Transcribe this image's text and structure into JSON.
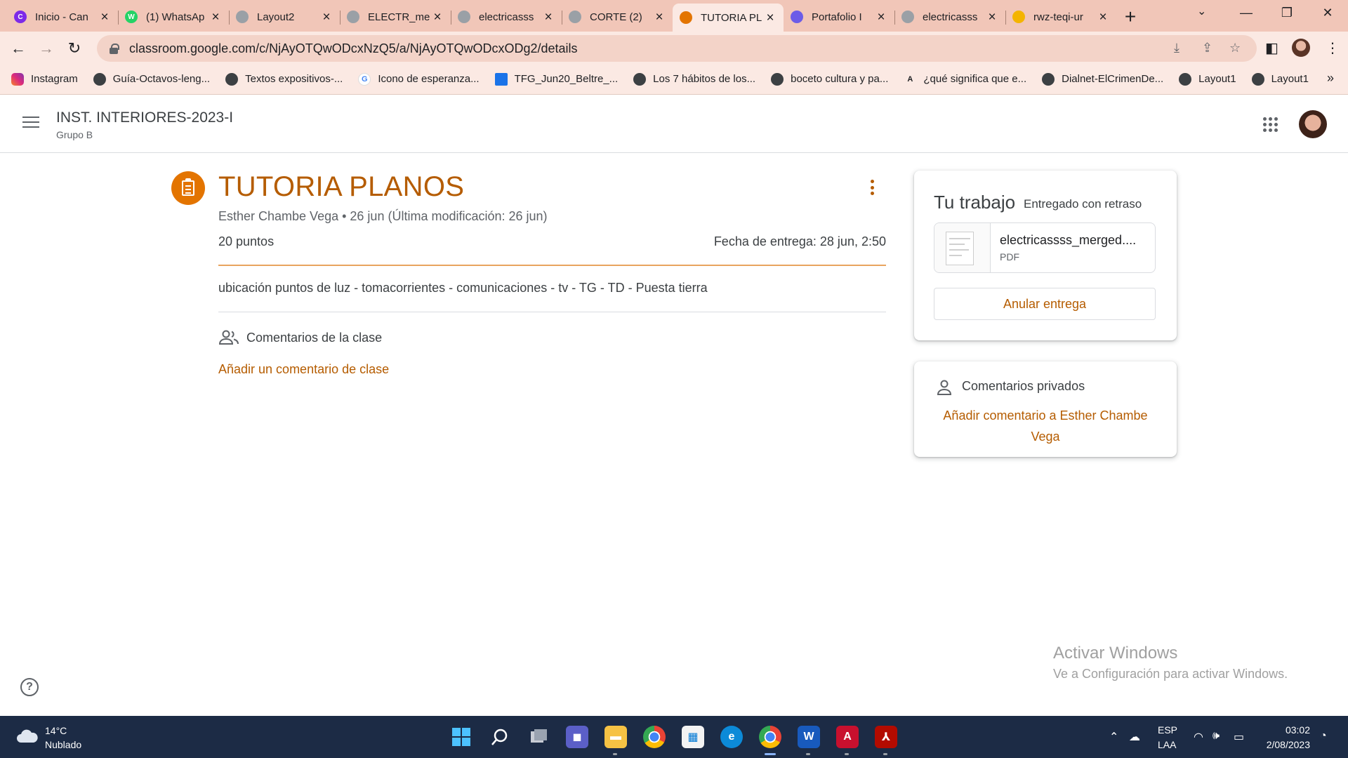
{
  "browser": {
    "tabs": [
      {
        "title": "Inicio - Can",
        "color": "#7d2ae8",
        "glyph": "C"
      },
      {
        "title": "(1) WhatsAp",
        "color": "#25d366",
        "glyph": "W"
      },
      {
        "title": "Layout2",
        "color": "#9aa0a6",
        "glyph": ""
      },
      {
        "title": "ELECTR_me",
        "color": "#9aa0a6",
        "glyph": ""
      },
      {
        "title": "electricasss",
        "color": "#9aa0a6",
        "glyph": ""
      },
      {
        "title": "CORTE (2)",
        "color": "#9aa0a6",
        "glyph": ""
      },
      {
        "title": "TUTORIA PL",
        "color": "#e37400",
        "glyph": "",
        "active": true
      },
      {
        "title": "Portafolio I",
        "color": "#6c5ce7",
        "glyph": ""
      },
      {
        "title": "electricasss",
        "color": "#9aa0a6",
        "glyph": ""
      },
      {
        "title": "rwz-teqi-ur",
        "color": "#f4b400",
        "glyph": ""
      }
    ],
    "url": "classroom.google.com/c/NjAyOTQwODcxNzQ5/a/NjAyOTQwODcxODg2/details",
    "bookmarks": [
      {
        "label": "Instagram",
        "kind": "insta"
      },
      {
        "label": "Guía-Octavos-leng...",
        "kind": "globe"
      },
      {
        "label": "Textos expositivos-...",
        "kind": "globe"
      },
      {
        "label": "Icono de esperanza...",
        "kind": "google"
      },
      {
        "label": "TFG_Jun20_Beltre_...",
        "kind": "doc"
      },
      {
        "label": "Los 7 hábitos de los...",
        "kind": "globe"
      },
      {
        "label": "boceto cultura y pa...",
        "kind": "globe"
      },
      {
        "label": "¿qué significa que e...",
        "kind": "letter"
      },
      {
        "label": "Dialnet-ElCrimenDe...",
        "kind": "globe"
      },
      {
        "label": "Layout1",
        "kind": "globe"
      },
      {
        "label": "Layout1",
        "kind": "globe"
      }
    ]
  },
  "classroom": {
    "class_name": "INST. INTERIORES-2023-I",
    "section": "Grupo B"
  },
  "assignment": {
    "title": "TUTORIA PLANOS",
    "meta": "Esther Chambe Vega • 26 jun (Última modificación: 26 jun)",
    "points": "20 puntos",
    "due": "Fecha de entrega: 28 jun, 2:50",
    "description": "ubicación puntos de luz - tomacorrientes - comunicaciones - tv - TG - TD - Puesta tierra",
    "class_comments_label": "Comentarios de la clase",
    "add_class_comment": "Añadir un comentario de clase"
  },
  "work": {
    "title": "Tu trabajo",
    "status": "Entregado con retraso",
    "attachment_name": "electricassss_merged....",
    "attachment_type": "PDF",
    "unsubmit_label": "Anular entrega"
  },
  "private_comments": {
    "title": "Comentarios privados",
    "add_label": "Añadir comentario a Esther Chambe Vega"
  },
  "watermark": {
    "title": "Activar Windows",
    "subtitle": "Ve a Configuración para activar Windows."
  },
  "taskbar": {
    "temperature": "14°C",
    "weather": "Nublado",
    "lang_top": "ESP",
    "lang_bottom": "LAA",
    "time": "03:02",
    "date": "2/08/2023"
  },
  "colors": {
    "accent": "#b55c00",
    "assignment_icon": "#e37400",
    "tab_strip": "#f1c6b8",
    "toolbar": "#fbe9e3",
    "taskbar": "#1c2b45"
  }
}
